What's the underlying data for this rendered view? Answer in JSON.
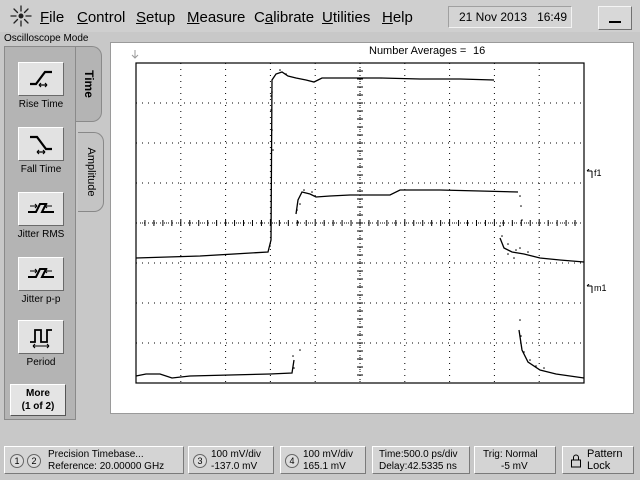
{
  "menu": {
    "items": [
      {
        "label": "File",
        "key": "F",
        "rest": "ile"
      },
      {
        "label": "Control",
        "key": "C",
        "rest": "ontrol"
      },
      {
        "label": "Setup",
        "key": "S",
        "rest": "etup"
      },
      {
        "label": "Measure",
        "key": "M",
        "rest": "easure"
      },
      {
        "label": "Calibrate",
        "key": "a",
        "pre": "C",
        "rest": "librate"
      },
      {
        "label": "Utilities",
        "key": "U",
        "rest": "tilities"
      },
      {
        "label": "Help",
        "key": "H",
        "rest": "elp"
      }
    ],
    "clock_date": "21 Nov 2013",
    "clock_time": "16:49"
  },
  "mode": "Oscilloscope Mode",
  "tabs": {
    "time": "Time",
    "amplitude": "Amplitude"
  },
  "tools": [
    {
      "label": "Rise Time",
      "icon": "rise-time-icon"
    },
    {
      "label": "Fall Time",
      "icon": "fall-time-icon"
    },
    {
      "label": "Jitter RMS",
      "icon": "jitter-rms-icon"
    },
    {
      "label": "Jitter p-p",
      "icon": "jitter-pp-icon"
    },
    {
      "label": "Period",
      "icon": "period-icon"
    }
  ],
  "more": {
    "line1": "More",
    "line2": "(1 of 2)"
  },
  "display": {
    "averages_label": "Number Averages =",
    "averages_value": "16",
    "marker_f1": "f1",
    "marker_m1": "m1"
  },
  "status": {
    "timebase": {
      "ch1": "1",
      "ch2": "2",
      "line1": "Precision Timebase...",
      "line2": "Reference: 20.00000 GHz"
    },
    "ch3": {
      "num": "3",
      "line1": "100 mV/div",
      "line2": "-137.0 mV"
    },
    "ch4": {
      "num": "4",
      "line1": "100 mV/div",
      "line2": "165.1 mV"
    },
    "time": {
      "line1": "Time:500.0 ps/div",
      "line2": "Delay:42.5335 ns"
    },
    "trig": {
      "line1": "Trig: Normal",
      "line2": "-5 mV"
    },
    "pattern": {
      "line1": "Pattern",
      "line2": "Lock"
    }
  },
  "colors": {
    "trace": "#000000",
    "grid_bg": "#ffffff",
    "panel": "#b4b4b4"
  }
}
